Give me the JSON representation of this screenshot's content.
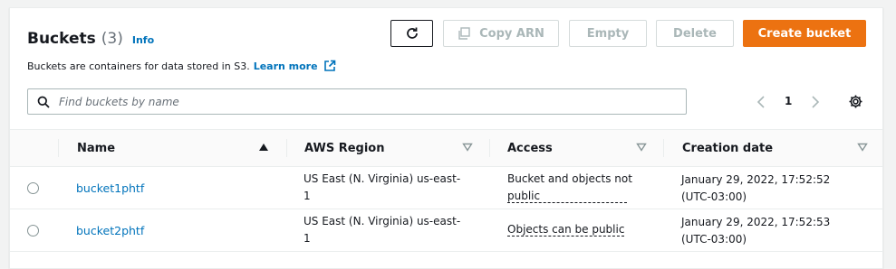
{
  "header": {
    "title": "Buckets",
    "count": "(3)",
    "info": "Info",
    "description": "Buckets are containers for data stored in S3.",
    "learn_more": "Learn more"
  },
  "toolbar": {
    "copy_arn": "Copy ARN",
    "empty": "Empty",
    "delete": "Delete",
    "create": "Create bucket"
  },
  "search": {
    "placeholder": "Find buckets by name",
    "value": ""
  },
  "pagination": {
    "page": "1"
  },
  "table": {
    "columns": [
      "Name",
      "AWS Region",
      "Access",
      "Creation date"
    ],
    "rows": [
      {
        "name": "bucket1phtf",
        "region_line1": "US East (N. Virginia) us-east-",
        "region_line2": "1",
        "access_line1": "Bucket and objects not",
        "access_line2": "public",
        "created_line1": "January 29, 2022, 17:52:52",
        "created_line2": "(UTC-03:00)"
      },
      {
        "name": "bucket2phtf",
        "region_line1": "US East (N. Virginia) us-east-",
        "region_line2": "1",
        "access_line1": "Objects can be public",
        "access_line2": "",
        "created_line1": "January 29, 2022, 17:52:53",
        "created_line2": "(UTC-03:00)"
      }
    ]
  },
  "colors": {
    "accent": "#ec7211",
    "link": "#0073bb",
    "disabled": "#aab7b8"
  },
  "icons": [
    "refresh-icon",
    "copy-icon",
    "external-link-icon",
    "search-icon",
    "chevron-left-icon",
    "chevron-right-icon",
    "settings-icon",
    "sort-asc-icon",
    "sort-icon"
  ]
}
